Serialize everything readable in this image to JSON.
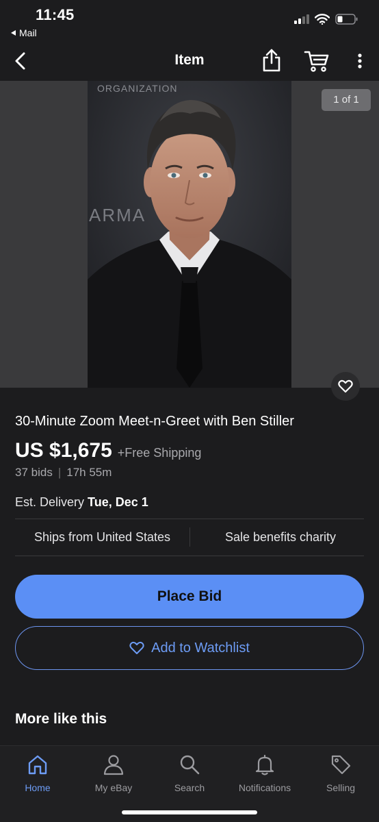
{
  "status_bar": {
    "time": "11:45",
    "back_app": "Mail"
  },
  "nav": {
    "title": "Item"
  },
  "photo": {
    "counter": "1 of 1",
    "backdrop_text": "ORGANIZATION",
    "backdrop_text_2": "ARMA"
  },
  "item": {
    "title": "30-Minute Zoom Meet-n-Greet with Ben Stiller",
    "price": "US $1,675",
    "shipping": "+Free Shipping",
    "bids": "37 bids",
    "time_left": "17h 55m",
    "delivery_label": "Est. Delivery",
    "delivery_date": "Tue, Dec 1"
  },
  "features": {
    "ships_from": "Ships from United States",
    "charity": "Sale benefits charity"
  },
  "actions": {
    "place_bid": "Place Bid",
    "add_watchlist": "Add to Watchlist"
  },
  "sections": {
    "more_like_this": "More like this"
  },
  "tab_bar": {
    "home": "Home",
    "my_ebay": "My eBay",
    "search": "Search",
    "notifications": "Notifications",
    "selling": "Selling"
  },
  "colors": {
    "accent": "#5b8ff5",
    "background": "#1c1c1e",
    "active_tab": "#6d9cf5"
  }
}
